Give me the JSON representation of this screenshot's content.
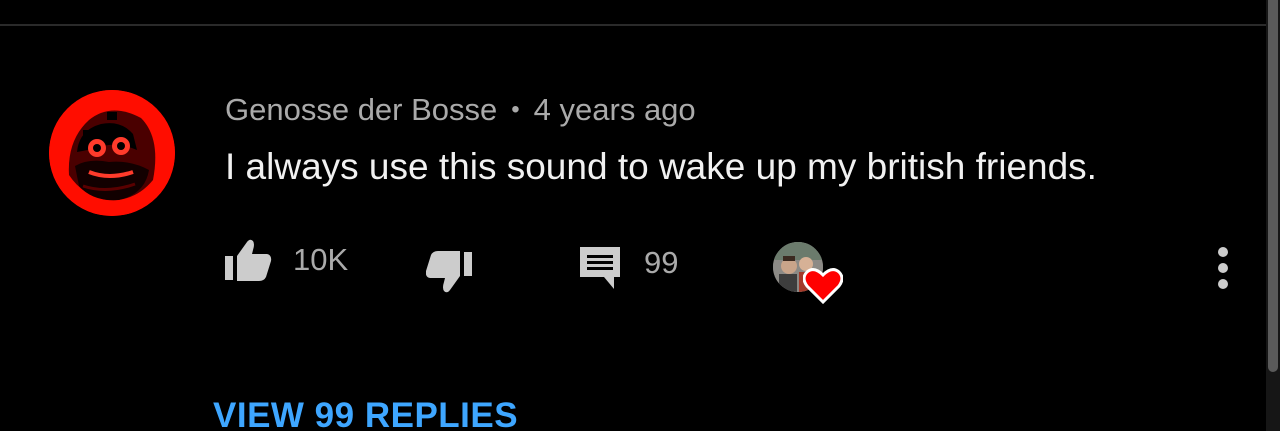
{
  "comment": {
    "author": "Genosse der Bosse",
    "separator": "•",
    "timestamp": "4 years ago",
    "text": "I always use this sound to wake up my british friends.",
    "like_count": "10K",
    "reply_count": "99",
    "view_replies_label": "VIEW 99 REPLIES",
    "avatar_icon": "red-bearded-face-avatar",
    "creator_heart": true
  },
  "colors": {
    "background": "#000000",
    "author_text": "#aaaaaa",
    "comment_text": "#f1f1f1",
    "link": "#3ea6ff",
    "avatar_red": "#ff0d00",
    "heart": "#ff0000"
  }
}
